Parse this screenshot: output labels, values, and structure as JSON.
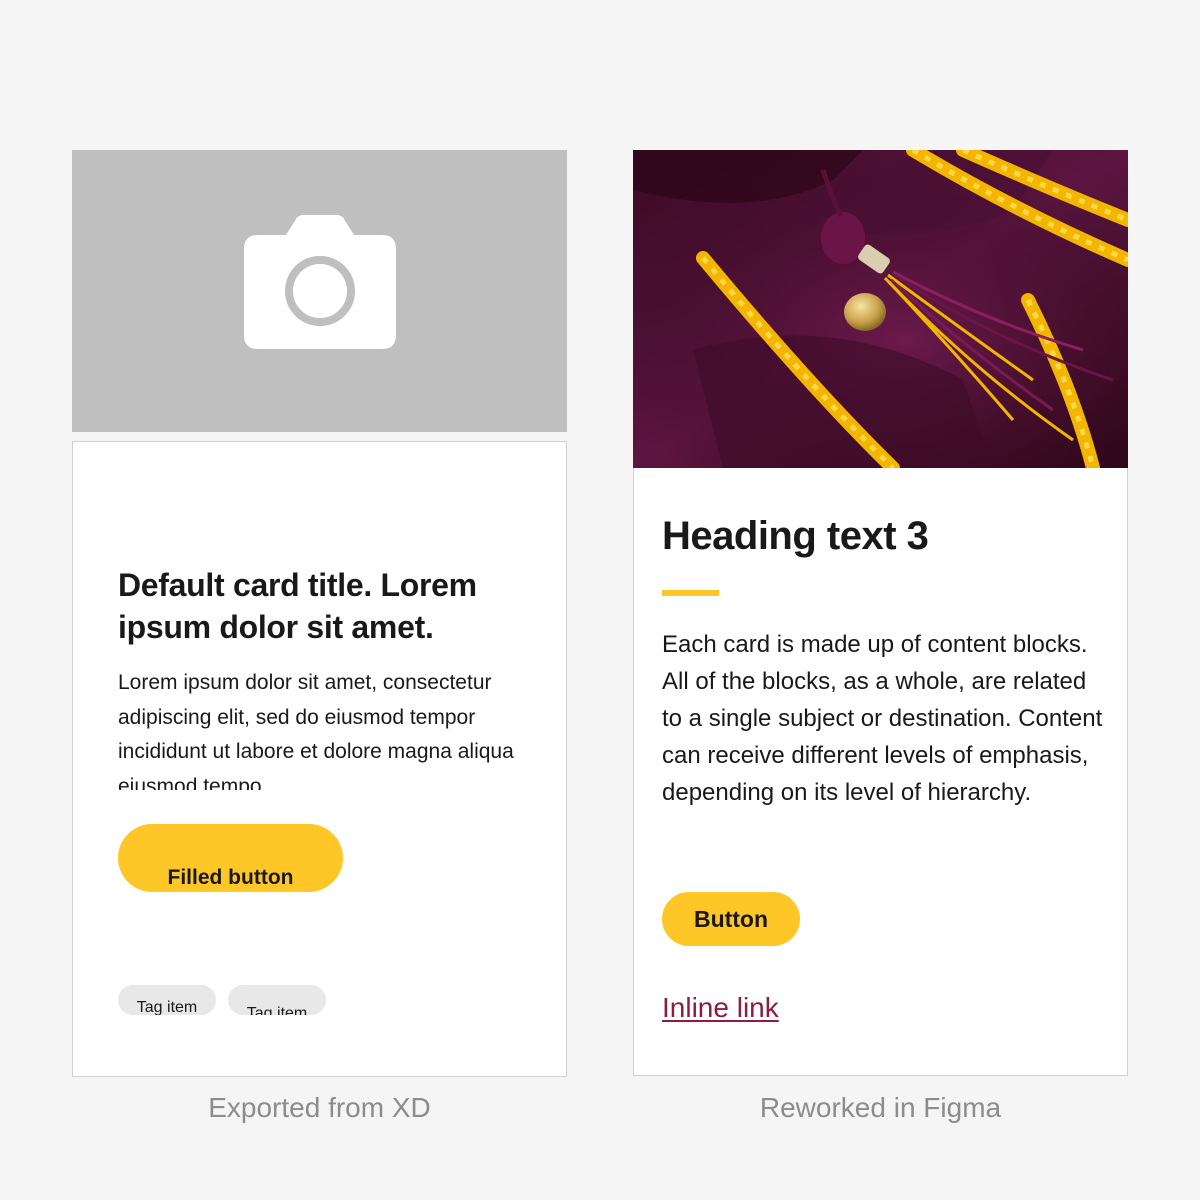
{
  "left_card": {
    "image_icon": "camera-icon",
    "title": "Default card title. Lorem ipsum dolor sit amet.",
    "body": "Lorem ipsum dolor sit amet, consectetur adipiscing elit, sed do eiusmod tempor incididunt ut labore et dolore magna aliqua eiusmod tempo.",
    "button_label": "Filled button",
    "tags": [
      "Tag item",
      "Tag item"
    ]
  },
  "right_card": {
    "image_icon": "graduation-tassel-image",
    "heading": "Heading text 3",
    "body": "Each card is made up of content blocks. All of the blocks, as a whole, are related to a single subject or destination. Content can receive different levels of emphasis, depending on its level of hierarchy.",
    "button_label": "Button",
    "link_label": "Inline link"
  },
  "captions": {
    "left": "Exported from XD",
    "right": "Reworked in Figma"
  },
  "colors": {
    "accent": "#ffc627",
    "link": "#8c1d40",
    "placeholder": "#bfbfbf",
    "background": "#f5f5f5"
  }
}
